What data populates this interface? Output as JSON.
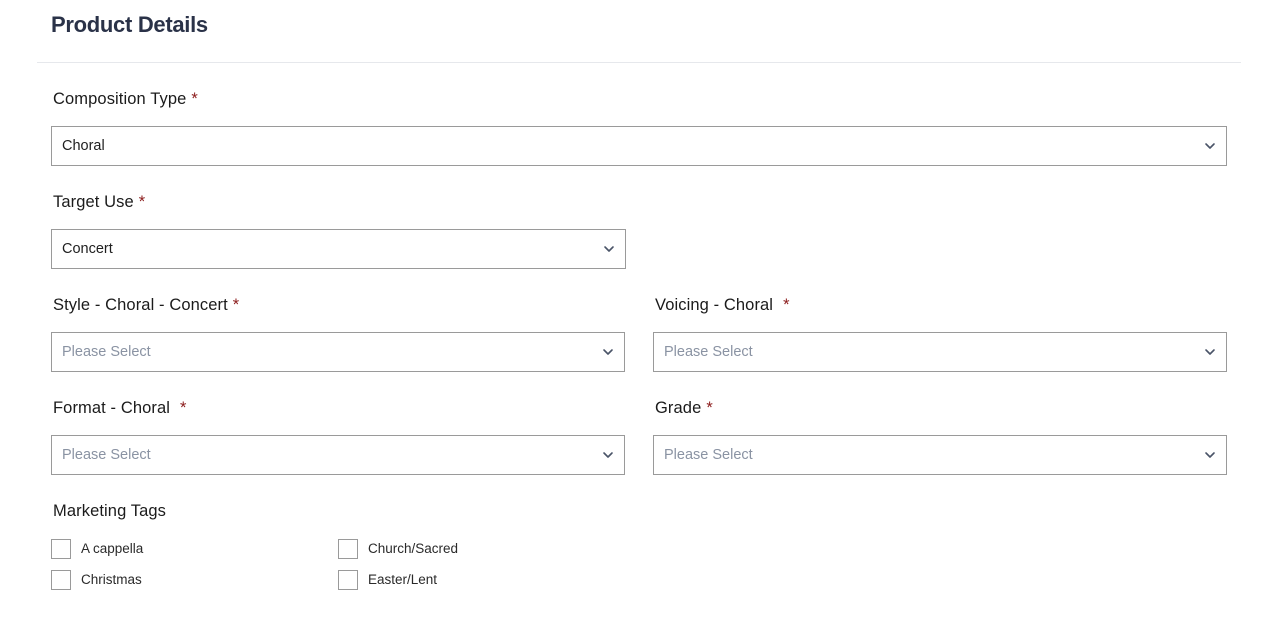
{
  "section": {
    "title": "Product Details"
  },
  "fields": {
    "composition_type": {
      "label": "Composition Type",
      "required": "*",
      "value": "Choral"
    },
    "target_use": {
      "label": "Target Use",
      "required": "*",
      "value": "Concert"
    },
    "style": {
      "label": "Style - Choral - Concert",
      "required": "*",
      "placeholder": "Please Select"
    },
    "voicing": {
      "label": "Voicing - Choral",
      "required": "*",
      "placeholder": "Please Select"
    },
    "format": {
      "label": "Format - Choral",
      "required": "*",
      "placeholder": "Please Select"
    },
    "grade": {
      "label": "Grade",
      "required": "*",
      "placeholder": "Please Select"
    }
  },
  "marketing_tags": {
    "label": "Marketing Tags",
    "options": [
      {
        "label": "A cappella",
        "checked": false
      },
      {
        "label": "Church/Sacred",
        "checked": false
      },
      {
        "label": "Christmas",
        "checked": false
      },
      {
        "label": "Easter/Lent",
        "checked": false
      }
    ]
  },
  "icons": {
    "dropdown": "chevron-down-icon"
  },
  "colors": {
    "heading": "#2a3248",
    "required": "#8b1a1a",
    "border": "#9a9a9a",
    "placeholder": "#8a93a3"
  }
}
